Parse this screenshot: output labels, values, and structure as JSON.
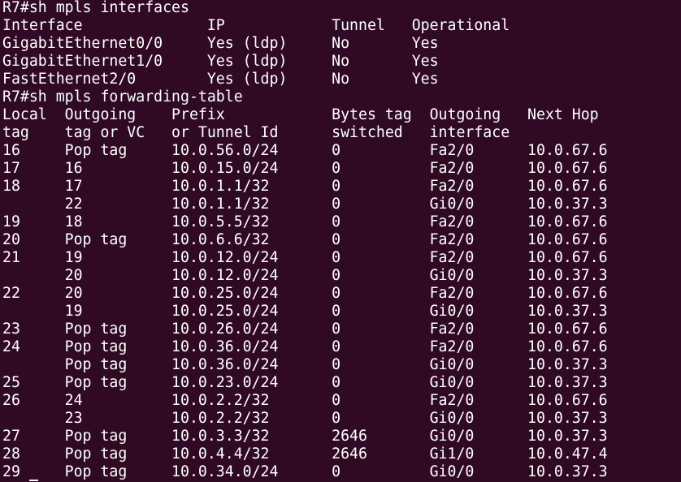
{
  "terminal": {
    "theme": {
      "background": "#300a24",
      "foreground": "#ffffff"
    },
    "lines": [
      "R7#sh mpls interfaces",
      "Interface              IP            Tunnel   Operational",
      "GigabitEthernet0/0     Yes (ldp)     No       Yes",
      "GigabitEthernet1/0     Yes (ldp)     No       Yes",
      "FastEthernet2/0        Yes (ldp)     No       Yes",
      "R7#sh mpls forwarding-table",
      "Local  Outgoing    Prefix            Bytes tag  Outgoing   Next Hop",
      "tag    tag or VC   or Tunnel Id      switched   interface",
      "16     Pop tag     10.0.56.0/24      0          Fa2/0      10.0.67.6",
      "17     16          10.0.15.0/24      0          Fa2/0      10.0.67.6",
      "18     17          10.0.1.1/32       0          Fa2/0      10.0.67.6",
      "       22          10.0.1.1/32       0          Gi0/0      10.0.37.3",
      "19     18          10.0.5.5/32       0          Fa2/0      10.0.67.6",
      "20     Pop tag     10.0.6.6/32       0          Fa2/0      10.0.67.6",
      "21     19          10.0.12.0/24      0          Fa2/0      10.0.67.6",
      "       20          10.0.12.0/24      0          Gi0/0      10.0.37.3",
      "22     20          10.0.25.0/24      0          Fa2/0      10.0.67.6",
      "       19          10.0.25.0/24      0          Gi0/0      10.0.37.3",
      "23     Pop tag     10.0.26.0/24      0          Fa2/0      10.0.67.6",
      "24     Pop tag     10.0.36.0/24      0          Fa2/0      10.0.67.6",
      "       Pop tag     10.0.36.0/24      0          Gi0/0      10.0.37.3",
      "25     Pop tag     10.0.23.0/24      0          Gi0/0      10.0.37.3",
      "26     24          10.0.2.2/32       0          Fa2/0      10.0.67.6",
      "       23          10.0.2.2/32       0          Gi0/0      10.0.37.3",
      "27     Pop tag     10.0.3.3/32       2646       Gi0/0      10.0.37.3",
      "28     Pop tag     10.0.4.4/32       2646       Gi1/0      10.0.47.4",
      "29     Pop tag     10.0.34.0/24      0          Gi0/0      10.0.37.3"
    ]
  }
}
